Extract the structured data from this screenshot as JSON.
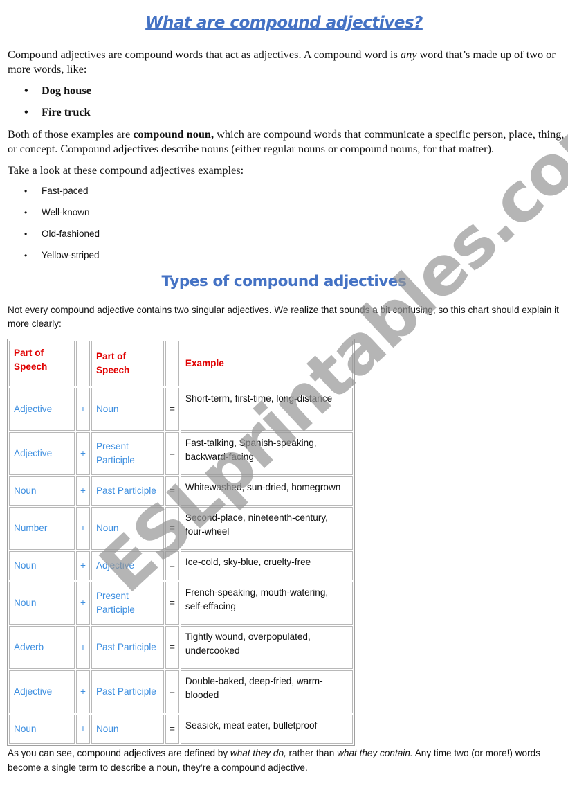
{
  "title": "What are compound adjectives?",
  "intro": {
    "before_any": "Compound adjectives are compound words that act as adjectives. A compound word is ",
    "any": "any",
    "after_any": " word that’s made up of two or more words, like:"
  },
  "noun_examples": [
    "Dog house",
    "Fire truck"
  ],
  "explanation": {
    "before_bold": "Both of those examples are ",
    "bold": "compound noun,",
    "after_bold": "  which are compound words that communicate a specific person, place, thing, or concept. Compound adjectives describe nouns (either regular nouns or compound nouns, for that matter)."
  },
  "examples_intro": "Take a look at these compound adjectives examples:",
  "adjective_examples": [
    "Fast-paced",
    "Well-known",
    "Old-fashioned",
    "Yellow-striped"
  ],
  "types_heading": "Types of compound adjectives",
  "types_intro": "Not every compound adjective contains two singular adjectives. We realize that sounds a bit confusing, so this chart should explain it more clearly:",
  "table": {
    "headers": [
      "Part of Speech",
      "",
      "Part of Speech",
      "",
      "Example"
    ],
    "rows": [
      {
        "a": "Adjective",
        "op": "+",
        "b": "Noun",
        "eq": "=",
        "example": "Short-term, first-time, long-distance"
      },
      {
        "a": "Adjective",
        "op": "+",
        "b": "Present Participle",
        "eq": "=",
        "example": "Fast-talking, Spanish-speaking, backward-facing"
      },
      {
        "a": "Noun",
        "op": "+",
        "b": "Past Participle",
        "eq": "=",
        "example": "Whitewashed, sun-dried, homegrown"
      },
      {
        "a": "Number",
        "op": "+",
        "b": "Noun",
        "eq": "=",
        "example": "Second-place, nineteenth-century, four-wheel"
      },
      {
        "a": "Noun",
        "op": "+",
        "b": "Adjective",
        "eq": "=",
        "example": "Ice-cold, sky-blue, cruelty-free"
      },
      {
        "a": "Noun",
        "op": "+",
        "b": "Present Participle",
        "eq": "=",
        "example": "French-speaking, mouth-watering, self-effacing"
      },
      {
        "a": "Adverb",
        "op": "+",
        "b": "Past Participle",
        "eq": "=",
        "example": "Tightly wound, overpopulated, undercooked"
      },
      {
        "a": "Adjective",
        "op": "+",
        "b": "Past Participle",
        "eq": "=",
        "example": "Double-baked, deep-fried, warm-blooded"
      },
      {
        "a": "Noun",
        "op": "+",
        "b": "Noun",
        "eq": "=",
        "example": "Seasick, meat eater, bulletproof"
      }
    ]
  },
  "conclusion": {
    "part1": "As you can see, compound adjectives are defined by ",
    "italic1": "what they do,",
    "part2": " rather than ",
    "italic2": "what they contain.",
    "part3": " Any time two (or more!) words become a single term to describe a noun, they’re a compound adjective."
  },
  "watermark": "ESLprintables.com",
  "bullet_glyph": "•",
  "colors": {
    "heading": "#4472c4",
    "table_header": "#e00000",
    "table_terms": "#3c8ee0"
  }
}
